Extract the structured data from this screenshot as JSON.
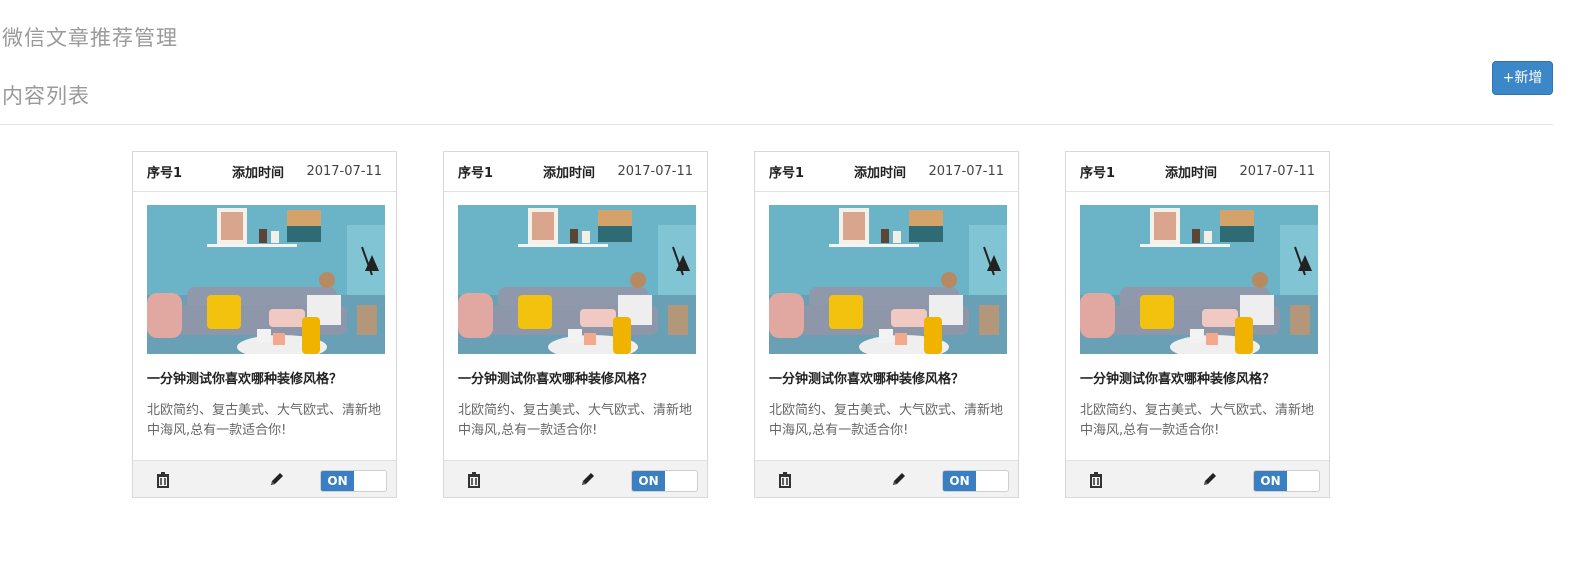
{
  "header": {
    "page_title": "微信文章推荐管理",
    "section_title": "内容列表",
    "add_button": "+新增"
  },
  "colors": {
    "accent": "#3c87c8",
    "toggle_on": "#3a7fc1"
  },
  "cards": [
    {
      "serial": "序号1",
      "added_label": "添加时间",
      "date": "2017-07-11",
      "title": "一分钟测试你喜欢哪种装修风格？",
      "desc": "北欧简约、复古美式、大气欧式、清新地中海风,总有一款适合你!",
      "toggle": "ON",
      "image": "living-room-sofa-photo"
    },
    {
      "serial": "序号1",
      "added_label": "添加时间",
      "date": "2017-07-11",
      "title": "一分钟测试你喜欢哪种装修风格？",
      "desc": "北欧简约、复古美式、大气欧式、清新地中海风,总有一款适合你!",
      "toggle": "ON",
      "image": "living-room-sofa-photo"
    },
    {
      "serial": "序号1",
      "added_label": "添加时间",
      "date": "2017-07-11",
      "title": "一分钟测试你喜欢哪种装修风格？",
      "desc": "北欧简约、复古美式、大气欧式、清新地中海风,总有一款适合你!",
      "toggle": "ON",
      "image": "living-room-sofa-photo"
    },
    {
      "serial": "序号1",
      "added_label": "添加时间",
      "date": "2017-07-11",
      "title": "一分钟测试你喜欢哪种装修风格？",
      "desc": "北欧简约、复古美式、大气欧式、清新地中海风,总有一款适合你!",
      "toggle": "ON",
      "image": "living-room-sofa-photo"
    }
  ],
  "icons": {
    "delete": "trash-icon",
    "edit": "pencil-icon"
  }
}
